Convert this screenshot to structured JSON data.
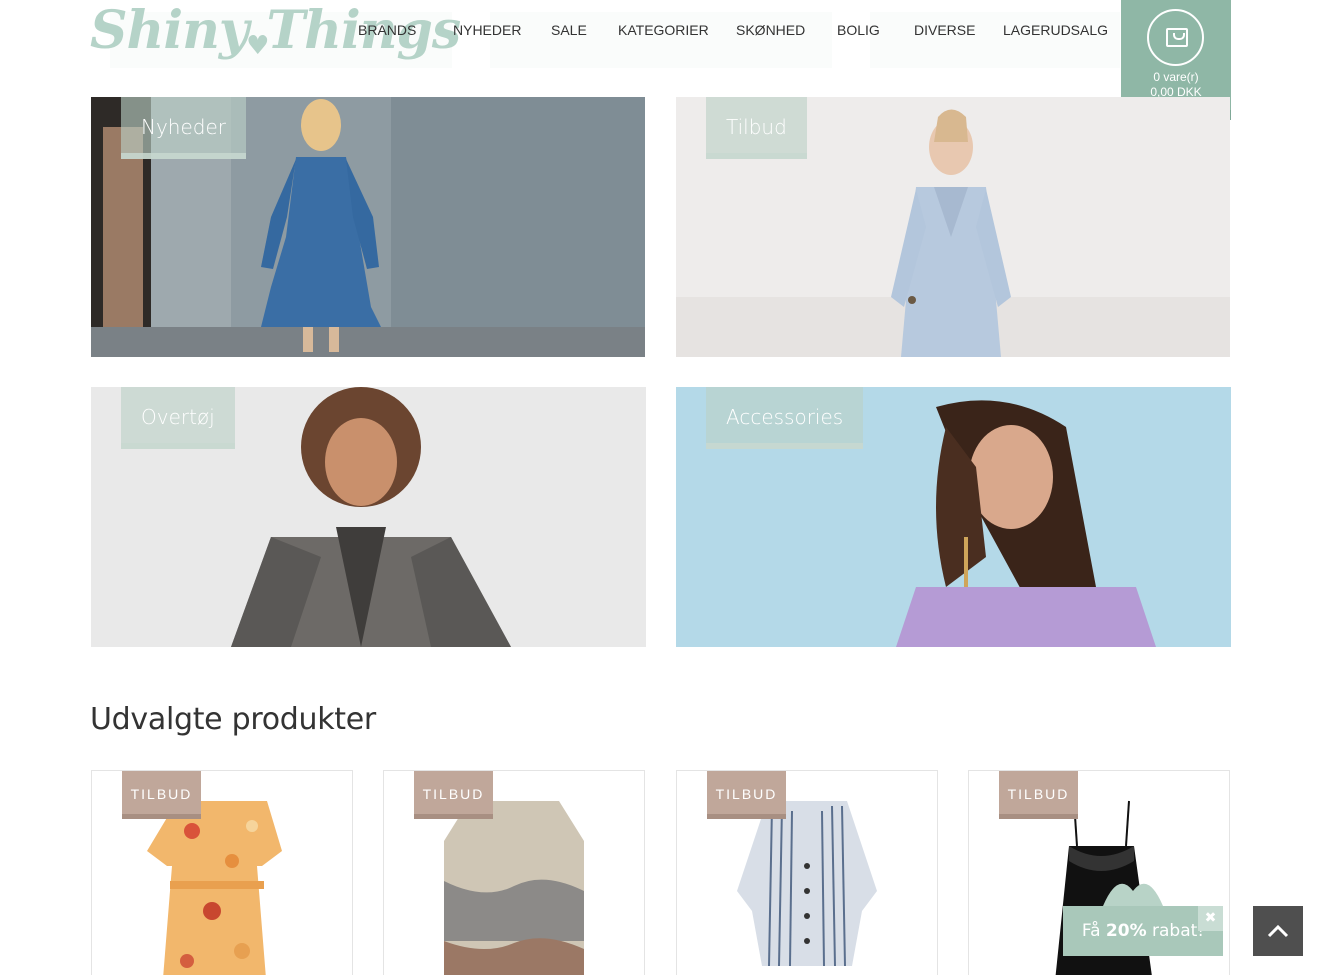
{
  "header": {
    "logo_text_1": "Shiny",
    "logo_text_2": "Things",
    "nav": [
      "BRANDS",
      "NYHEDER",
      "SALE",
      "KATEGORIER",
      "SKØNHED",
      "BOLIG",
      "DIVERSE",
      "LAGERUDSALG"
    ],
    "cart": {
      "icon": "shopping-bag-icon",
      "items": "0 vare(r)",
      "total": "0,00 DKK"
    }
  },
  "tiles": [
    {
      "label": "Nyheder"
    },
    {
      "label": "Tilbud"
    },
    {
      "label": "Overtøj"
    },
    {
      "label": "Accessories"
    }
  ],
  "section_title": "Udvalgte produkter",
  "products": [
    {
      "badge": "TILBUD"
    },
    {
      "badge": "TILBUD"
    },
    {
      "badge": "TILBUD"
    },
    {
      "badge": "TILBUD"
    }
  ],
  "promo": {
    "prefix": "Få ",
    "percent": "20%",
    "suffix": " rabat!",
    "close_icon": "close-icon"
  },
  "back_to_top": {
    "icon": "chevron-up-icon"
  },
  "colors": {
    "accent": "#8fb7a6",
    "badge": "#c0a79a",
    "logo": "#b5d3c8"
  }
}
